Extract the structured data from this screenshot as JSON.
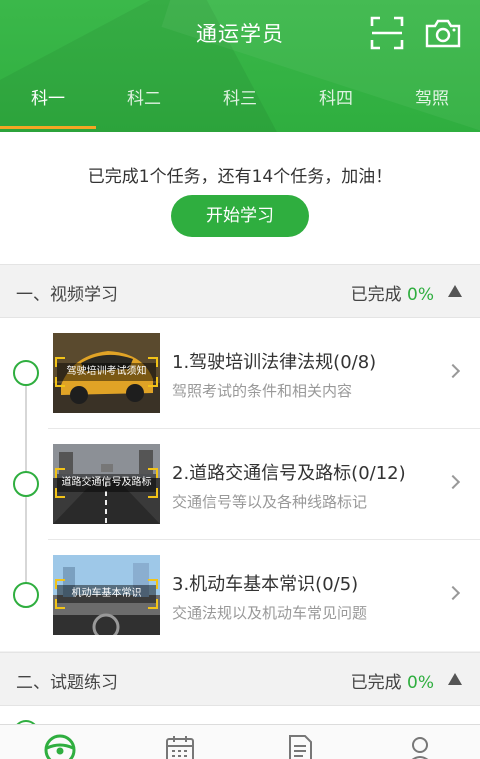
{
  "header": {
    "title": "通运学员",
    "icons": [
      "scan-icon",
      "camera-icon"
    ],
    "tabs": [
      {
        "label": "科一",
        "active": true
      },
      {
        "label": "科二",
        "active": false
      },
      {
        "label": "科三",
        "active": false
      },
      {
        "label": "科四",
        "active": false
      },
      {
        "label": "驾照",
        "active": false
      }
    ]
  },
  "progress": {
    "message": "已完成1个任务，还有14个任务，加油！",
    "start_label": "开始学习"
  },
  "sections": [
    {
      "title": "一、视频学习",
      "status_label": "已完成",
      "percent": "0%",
      "expanded": true
    },
    {
      "title": "二、试题练习",
      "status_label": "已完成",
      "percent": "0%",
      "expanded": true
    }
  ],
  "lessons": [
    {
      "thumb_caption": "驾驶培训考试须知",
      "title": "1.驾驶培训法律法规(0/8)",
      "desc": "驾照考试的条件和相关内容"
    },
    {
      "thumb_caption": "道路交通信号及路标",
      "title": "2.道路交通信号及路标(0/12)",
      "desc": "交通信号等以及各种线路标记"
    },
    {
      "thumb_caption": "机动车基本常识",
      "title": "3.机动车基本常识(0/5)",
      "desc": "交通法规以及机动车常见问题"
    }
  ],
  "bottom_nav": [
    "steering-wheel-icon",
    "calendar-icon",
    "document-icon",
    "person-icon"
  ],
  "colors": {
    "accent": "#2fae3f",
    "tab_indicator": "#f5a623"
  }
}
